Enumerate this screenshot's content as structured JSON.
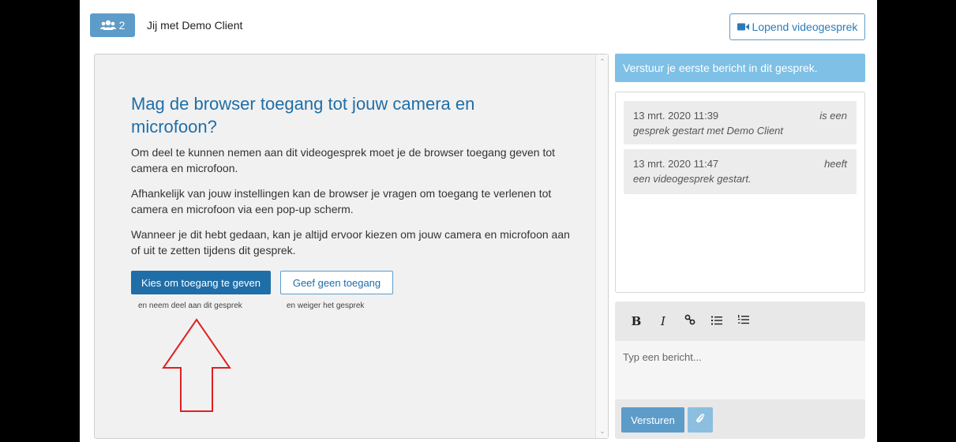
{
  "header": {
    "participant_count": "2",
    "conversation_title": "Jij met Demo Client",
    "video_button_label": "Lopend videogesprek"
  },
  "main": {
    "heading": "Mag de browser toegang tot jouw camera en microfoon?",
    "paragraphs": [
      "Om deel te kunnen nemen aan dit videogesprek moet je de browser toegang geven tot camera en microfoon.",
      "Afhankelijk van jouw instellingen kan de browser je vragen om toegang te verlenen tot camera en microfoon via een pop-up scherm.",
      "Wanneer je dit hebt gedaan, kan je altijd ervoor kiezen om jouw camera en microfoon aan of uit te zetten tijdens dit gesprek."
    ],
    "allow_button": "Kies om toegang te geven",
    "allow_hint": "en neem deel aan dit gesprek",
    "deny_button": "Geef geen toegang",
    "deny_hint": "en weiger het gesprek"
  },
  "chat": {
    "notice": "Verstuur je eerste bericht in dit gesprek.",
    "messages": [
      {
        "timestamp": "13 mrt. 2020 11:39",
        "action": "is een",
        "rest": "gesprek gestart met Demo Client"
      },
      {
        "timestamp": "13 mrt. 2020 11:47",
        "action": "heeft",
        "rest": "een videogesprek gestart."
      }
    ],
    "input_placeholder": "Typ een bericht...",
    "send_button": "Versturen",
    "toolbar": {
      "bold": "B",
      "italic": "I"
    }
  },
  "colors": {
    "primary": "#1f6ea8",
    "accent": "#5d9cc9",
    "notice_bg": "#7ec0e6",
    "arrow": "#e02020"
  },
  "icons": [
    "users-icon",
    "video-camera-icon",
    "link-icon",
    "bullet-list-icon",
    "numbered-list-icon",
    "paperclip-icon",
    "arrow-up-icon"
  ]
}
